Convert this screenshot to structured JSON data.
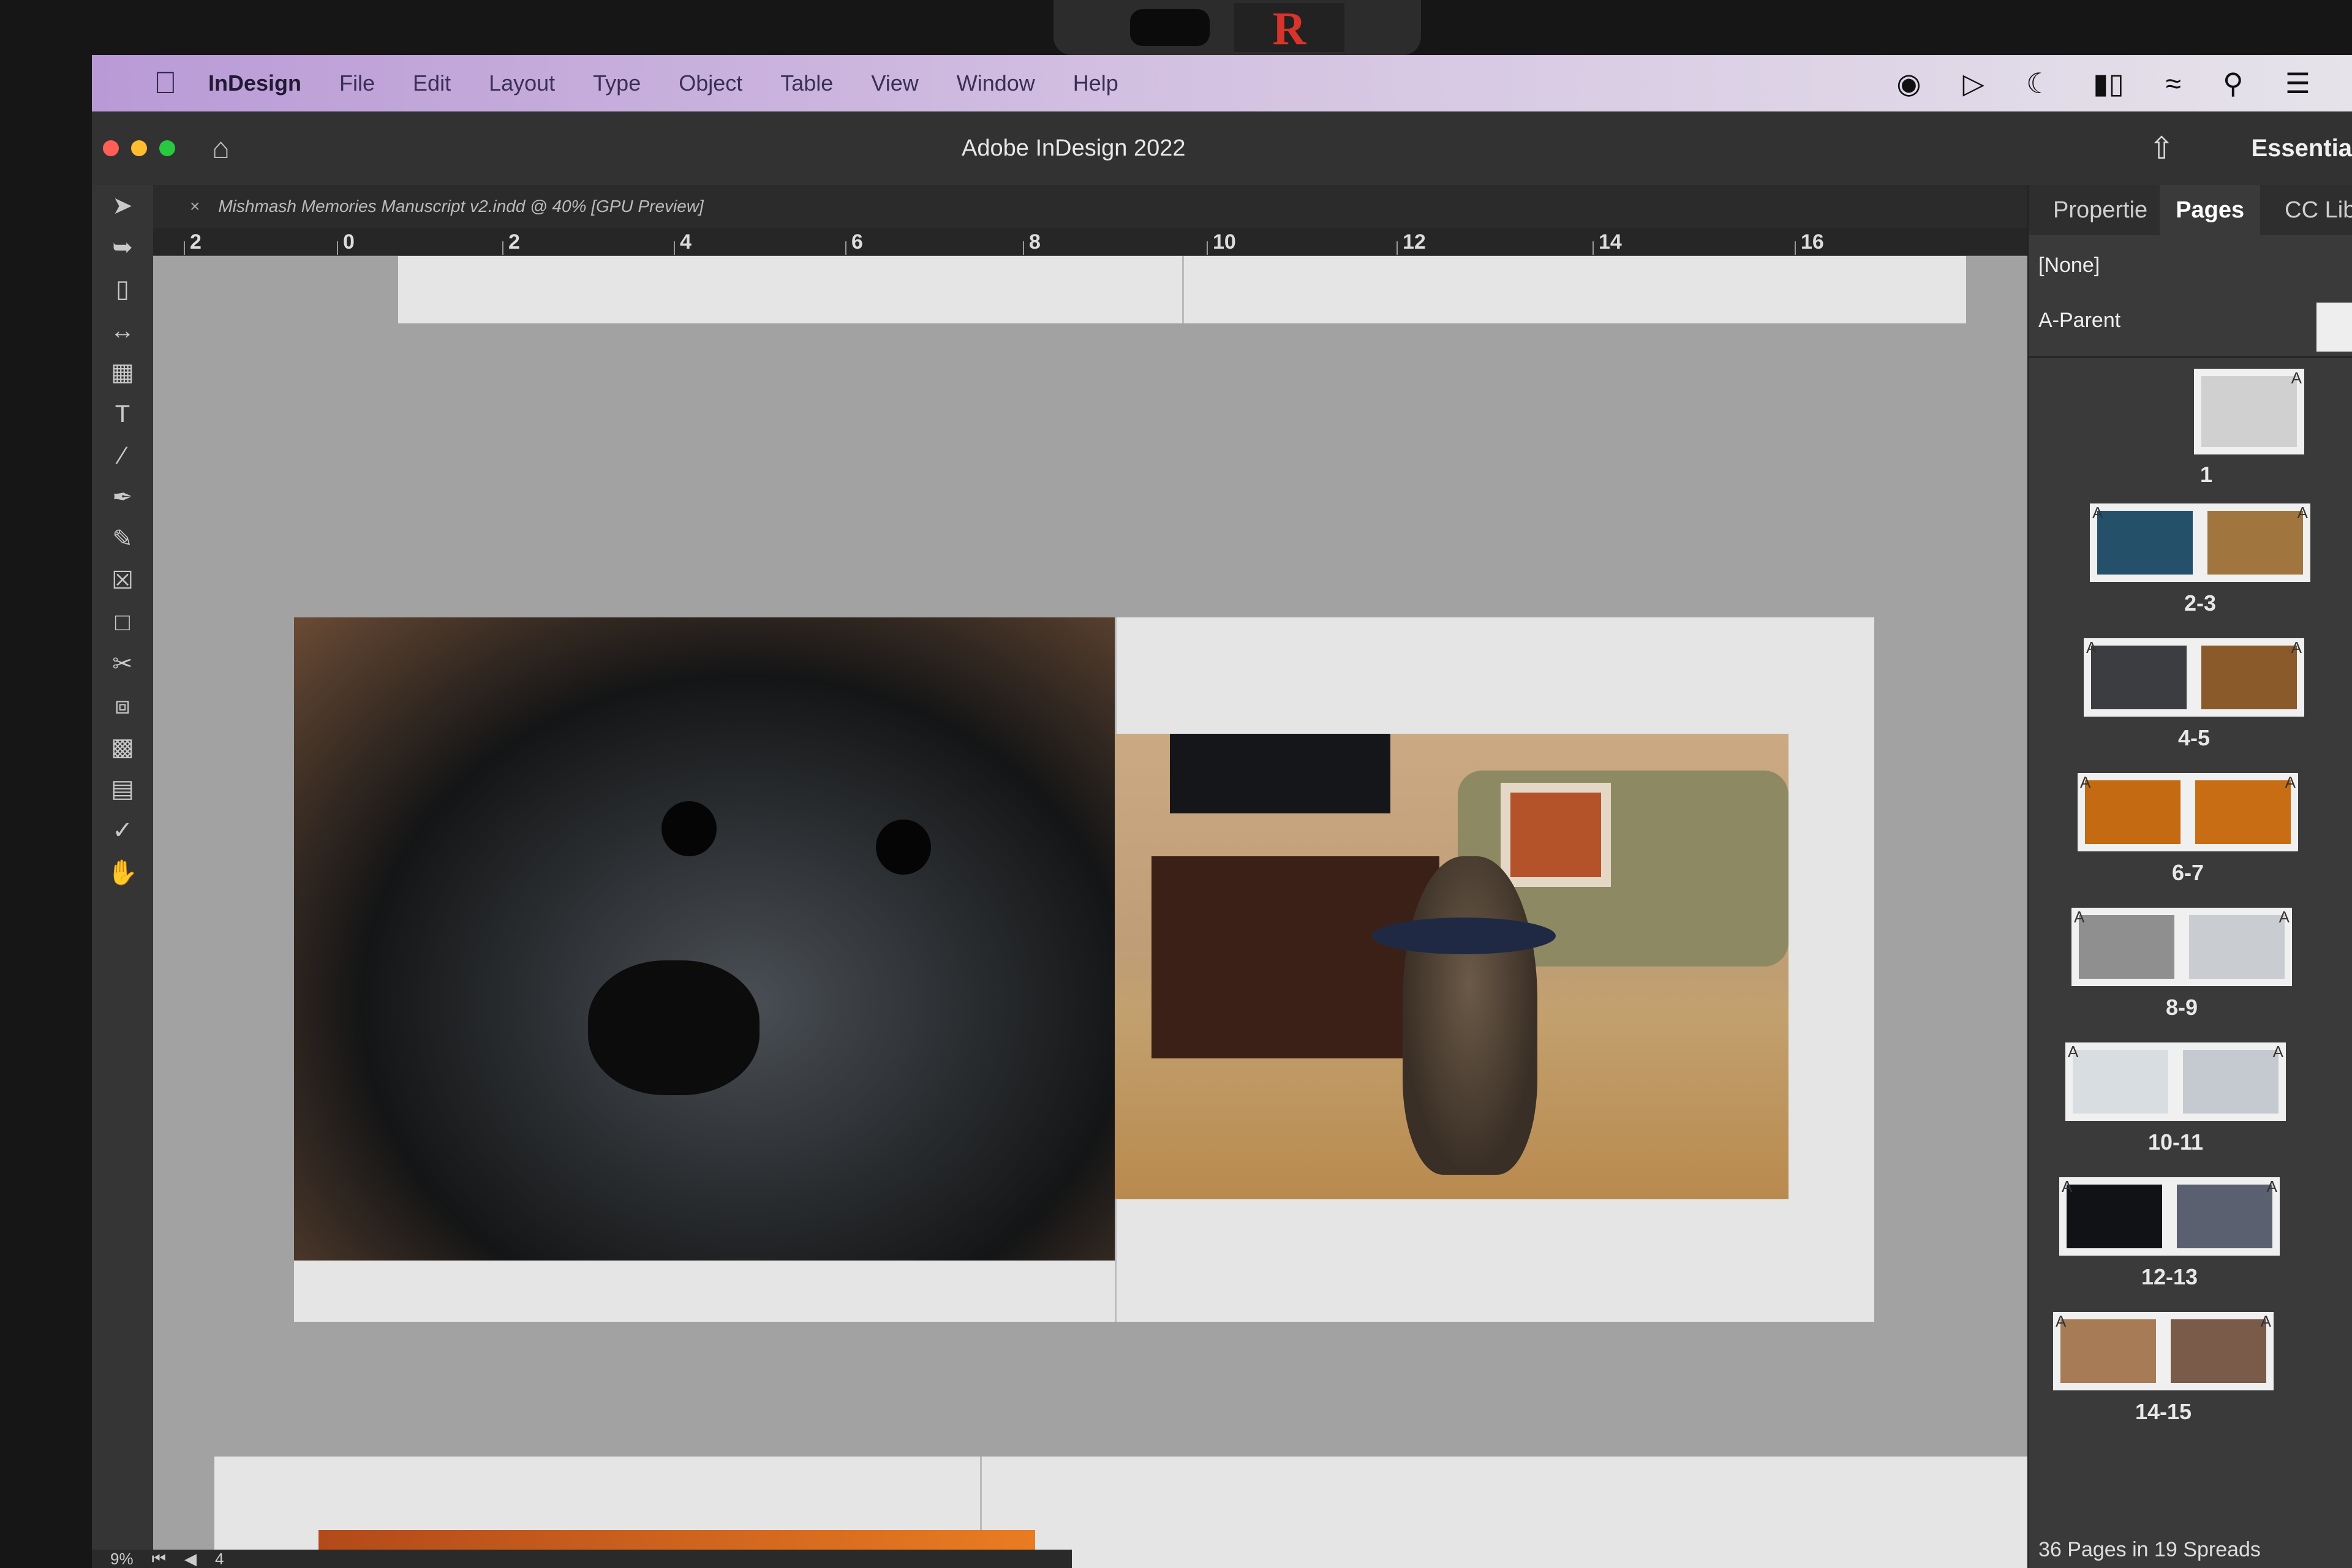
{
  "menubar": {
    "app": "InDesign",
    "items": [
      "File",
      "Edit",
      "Layout",
      "Type",
      "Object",
      "Table",
      "View",
      "Window",
      "Help"
    ]
  },
  "titlebar": {
    "title": "Adobe InDesign 2022",
    "workspace": "Essentia"
  },
  "document": {
    "tab": "Mishmash Memories Manuscript v2.indd @ 40% [GPU Preview]"
  },
  "ruler": {
    "labels": [
      "2",
      "0",
      "2",
      "4",
      "6",
      "8",
      "10",
      "12",
      "14",
      "16"
    ]
  },
  "webcam": {
    "sticker": "R"
  },
  "panel": {
    "tabs": [
      "Propertie",
      "Pages",
      "CC Libra"
    ],
    "parent_none": "[None]",
    "parent_a": "A-Parent",
    "spreads": [
      {
        "label": "1",
        "color_a": "#d0d0d0",
        "color_b": null
      },
      {
        "label": "2-3",
        "color_a": "#24506a",
        "color_b": "#a0753e"
      },
      {
        "label": "4-5",
        "color_a": "#3b3d40",
        "color_b": "#8a5a2a"
      },
      {
        "label": "6-7",
        "color_a": "#c46a12",
        "color_b": "#c96d14"
      },
      {
        "label": "8-9",
        "color_a": "#8f8f8f",
        "color_b": "#c9ccd0"
      },
      {
        "label": "10-11",
        "color_a": "#d8dde2",
        "color_b": "#c5cad0"
      },
      {
        "label": "12-13",
        "color_a": "#101216",
        "color_b": "#5a6070"
      },
      {
        "label": "14-15",
        "color_a": "#a77b55",
        "color_b": "#7a5a48"
      }
    ],
    "footer": "36 Pages in 19 Spreads",
    "parent_marker": "A"
  },
  "status": {
    "zoom": "9%",
    "page": "4"
  }
}
